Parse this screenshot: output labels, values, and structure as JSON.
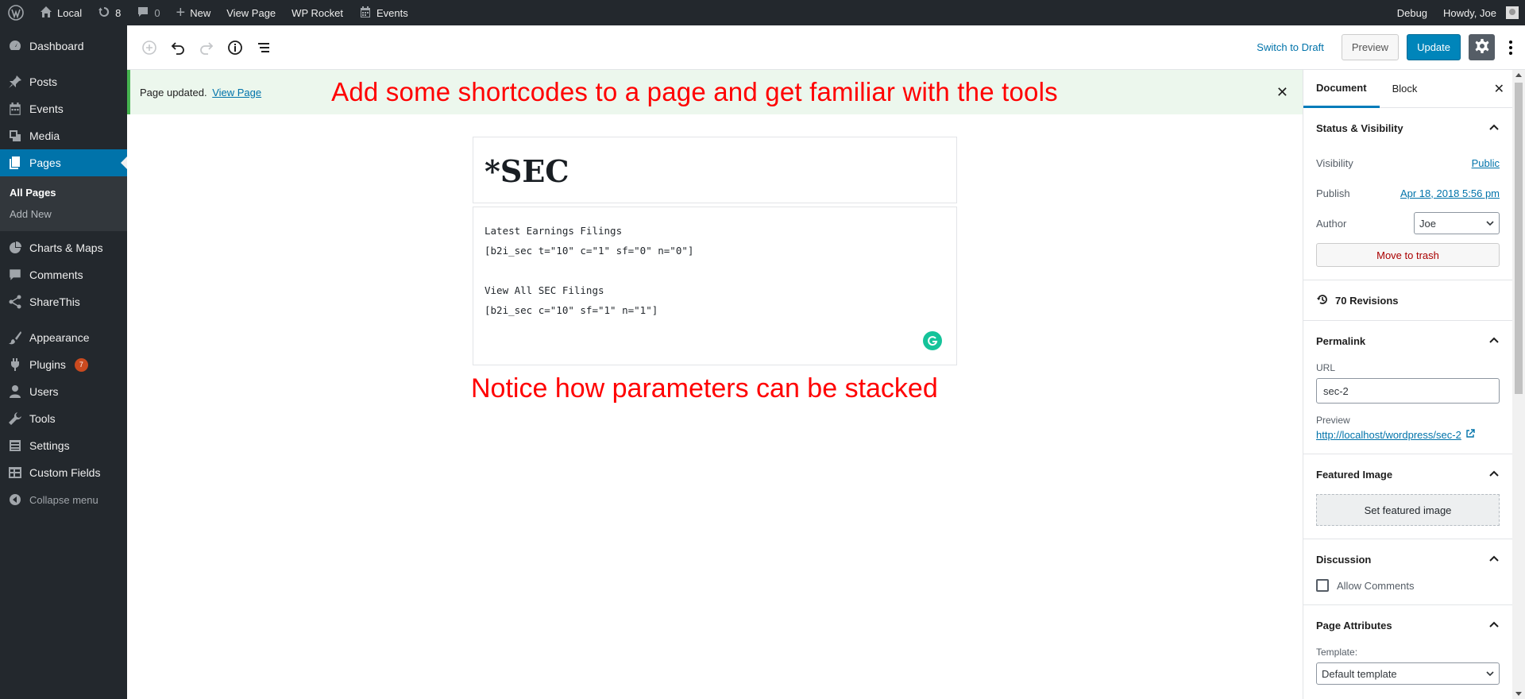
{
  "adminbar": {
    "site_name": "Local",
    "updates_count": "8",
    "comments_count": "0",
    "new_label": "New",
    "view_page_label": "View Page",
    "wp_rocket_label": "WP Rocket",
    "events_label": "Events",
    "debug_label": "Debug",
    "howdy_label": "Howdy, Joe"
  },
  "sidebar": {
    "items": [
      {
        "label": "Dashboard",
        "icon": "dashboard-icon"
      },
      {
        "label": "Posts",
        "icon": "pin-icon"
      },
      {
        "label": "Events",
        "icon": "calendar-icon"
      },
      {
        "label": "Media",
        "icon": "media-icon"
      },
      {
        "label": "Pages",
        "icon": "pages-icon"
      },
      {
        "label": "Charts & Maps",
        "icon": "pie-chart-icon"
      },
      {
        "label": "Comments",
        "icon": "comment-icon"
      },
      {
        "label": "ShareThis",
        "icon": "share-icon"
      },
      {
        "label": "Appearance",
        "icon": "brush-icon"
      },
      {
        "label": "Plugins",
        "icon": "plug-icon",
        "badge": "7"
      },
      {
        "label": "Users",
        "icon": "user-icon"
      },
      {
        "label": "Tools",
        "icon": "wrench-icon"
      },
      {
        "label": "Settings",
        "icon": "settings-icon"
      },
      {
        "label": "Custom Fields",
        "icon": "table-icon"
      }
    ],
    "submenu": [
      "All Pages",
      "Add New"
    ],
    "collapse_label": "Collapse menu"
  },
  "toolbar": {
    "switch_to_draft": "Switch to Draft",
    "preview": "Preview",
    "update": "Update"
  },
  "notice": {
    "message": "Page updated.",
    "link": "View Page",
    "annotation": "Add some shortcodes to a page and get familiar with the tools"
  },
  "content": {
    "title": "*SEC",
    "shortcode_text": "Latest Earnings Filings\n[b2i_sec t=\"10\" c=\"1\" sf=\"0\" n=\"0\"]\n\nView All SEC Filings\n[b2i_sec c=\"10\" sf=\"1\" n=\"1\"]",
    "annotation": "Notice how parameters can be stacked"
  },
  "panel": {
    "tabs": [
      "Document",
      "Block"
    ],
    "status": {
      "title": "Status & Visibility",
      "visibility_label": "Visibility",
      "visibility_value": "Public",
      "publish_label": "Publish",
      "publish_value": "Apr 18, 2018 5:56 pm",
      "author_label": "Author",
      "author_value": "Joe",
      "trash": "Move to trash"
    },
    "revisions": "70 Revisions",
    "permalink": {
      "title": "Permalink",
      "url_label": "URL",
      "url_value": "sec-2",
      "preview_label": "Preview",
      "preview_link": "http://localhost/wordpress/sec-2"
    },
    "featured": {
      "title": "Featured Image",
      "button": "Set featured image"
    },
    "discussion": {
      "title": "Discussion",
      "allow_comments": "Allow Comments"
    },
    "attributes": {
      "title": "Page Attributes",
      "template_label": "Template:",
      "template_value": "Default template"
    }
  },
  "colors": {
    "admin_bg": "#23282d",
    "accent": "#0073aa",
    "update_button": "#0085ba",
    "annotation": "#ff0000",
    "notice_bg": "#ecf7ed",
    "notice_border": "#46b450"
  }
}
